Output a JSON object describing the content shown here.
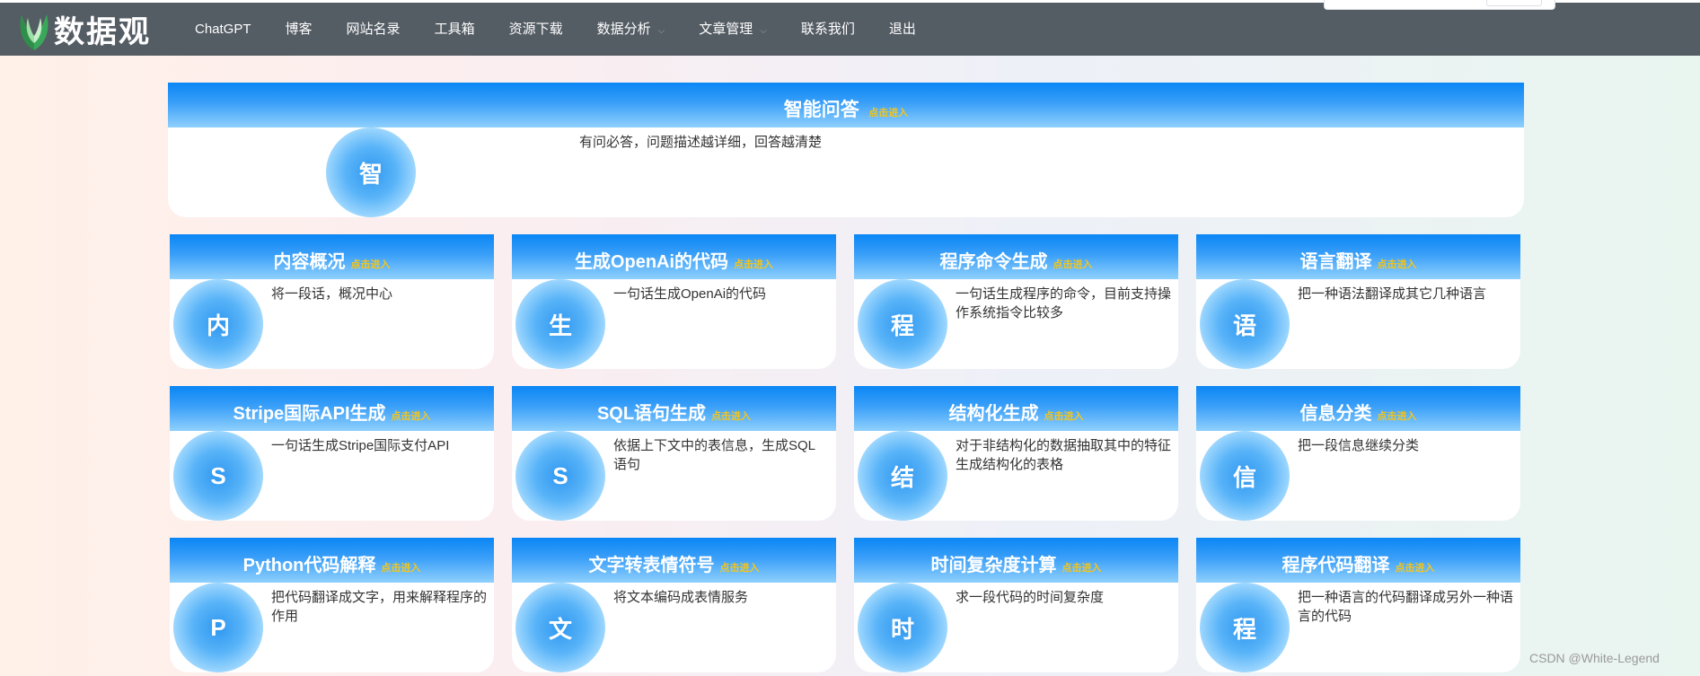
{
  "brand": {
    "name": "数据观"
  },
  "nav": [
    {
      "label": "ChatGPT",
      "dropdown": false
    },
    {
      "label": "博客",
      "dropdown": false
    },
    {
      "label": "网站名录",
      "dropdown": false
    },
    {
      "label": "工具箱",
      "dropdown": false
    },
    {
      "label": "资源下载",
      "dropdown": false
    },
    {
      "label": "数据分析",
      "dropdown": true
    },
    {
      "label": "文章管理",
      "dropdown": true
    },
    {
      "label": "联系我们",
      "dropdown": false
    },
    {
      "label": "退出",
      "dropdown": false
    }
  ],
  "enter_label": "点击进入",
  "featured": {
    "title": "智能问答",
    "icon_char": "智",
    "desc": "有问必答，问题描述越详细，回答越清楚"
  },
  "cards": [
    {
      "title": "内容概况",
      "icon_char": "内",
      "desc": "将一段话，概况中心"
    },
    {
      "title": "生成OpenAi的代码",
      "icon_char": "生",
      "desc": "一句话生成OpenAi的代码"
    },
    {
      "title": "程序命令生成",
      "icon_char": "程",
      "desc": "一句话生成程序的命令，目前支持操作系统指令比较多"
    },
    {
      "title": "语言翻译",
      "icon_char": "语",
      "desc": "把一种语法翻译成其它几种语言"
    },
    {
      "title": "Stripe国际API生成",
      "icon_char": "S",
      "desc": "一句话生成Stripe国际支付API"
    },
    {
      "title": "SQL语句生成",
      "icon_char": "S",
      "desc": "依据上下文中的表信息，生成SQL语句"
    },
    {
      "title": "结构化生成",
      "icon_char": "结",
      "desc": "对于非结构化的数据抽取其中的特征生成结构化的表格"
    },
    {
      "title": "信息分类",
      "icon_char": "信",
      "desc": "把一段信息继续分类"
    },
    {
      "title": "Python代码解释",
      "icon_char": "P",
      "desc": "把代码翻译成文字，用来解释程序的作用"
    },
    {
      "title": "文字转表情符号",
      "icon_char": "文",
      "desc": "将文本编码成表情服务"
    },
    {
      "title": "时间复杂度计算",
      "icon_char": "时",
      "desc": "求一段代码的时间复杂度"
    },
    {
      "title": "程序代码翻译",
      "icon_char": "程",
      "desc": "把一种语言的代码翻译成另外一种语言的代码"
    }
  ],
  "watermark": "CSDN @White-Legend"
}
